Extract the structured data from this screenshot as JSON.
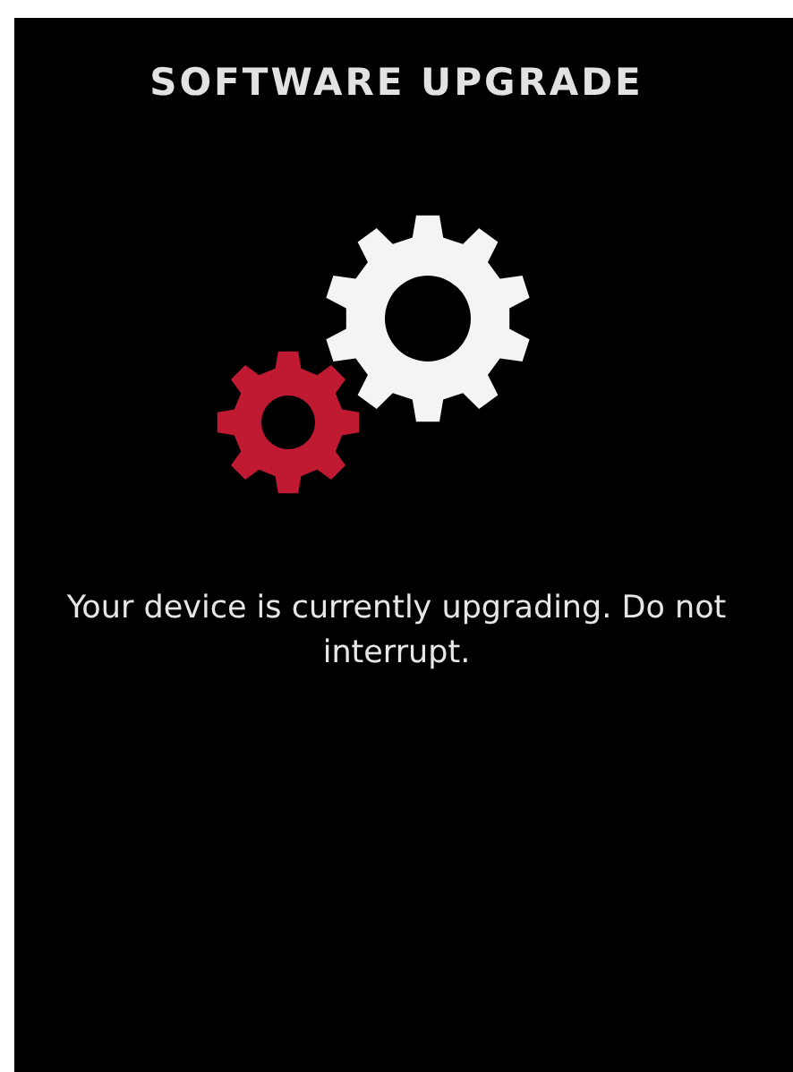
{
  "title": "SOFTWARE UPGRADE",
  "message": "Your device is currently upgrading. Do not interrupt."
}
